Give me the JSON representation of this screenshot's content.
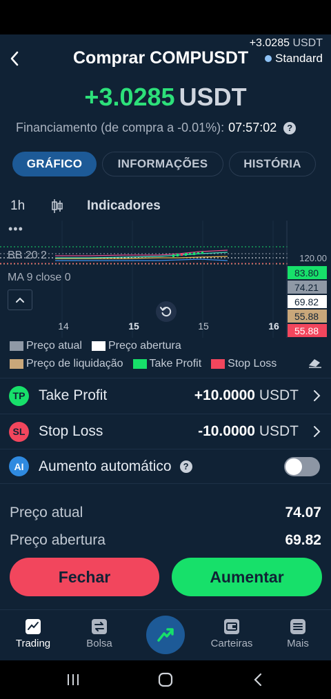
{
  "header": {
    "title": "Comprar COMPUSDT",
    "pnl_small": "+3.0285",
    "pnl_small_unit": "USDT",
    "mode": "Standard"
  },
  "pnl": {
    "value": "+3.0285",
    "unit": "USDT"
  },
  "funding": {
    "label": "Financiamento (de compra a -0.01%):",
    "countdown": "07:57:02"
  },
  "tabs": [
    {
      "label": "GRÁFICO",
      "active": true
    },
    {
      "label": "INFORMAÇÕES",
      "active": false
    },
    {
      "label": "HISTÓRIA",
      "active": false
    }
  ],
  "chart_toolbar": {
    "interval": "1h",
    "indicators_label": "Indicadores"
  },
  "chart_data": {
    "type": "line",
    "indicators": [
      "BB 20 2",
      "MA 9 close 0"
    ],
    "axis_top_label": "120.00",
    "price_tags": [
      {
        "label": "83.80",
        "kind": "Take Profit",
        "color": "#17e06a"
      },
      {
        "label": "74.21",
        "kind": "Preço atual",
        "color": "#8f99a6"
      },
      {
        "label": "69.82",
        "kind": "Preço abertura",
        "color": "#ffffff"
      },
      {
        "label": "55.88",
        "kind": "Preço de liquidação",
        "color": "#c9a77a"
      },
      {
        "label": "55.88",
        "kind": "Stop Loss",
        "color": "#f2465d"
      }
    ],
    "x_ticks": [
      {
        "label": "14",
        "bold": false
      },
      {
        "label": "15",
        "bold": true
      },
      {
        "label": "15",
        "bold": false
      },
      {
        "label": "16",
        "bold": true
      }
    ]
  },
  "legend": [
    {
      "label": "Preço atual",
      "color": "#8f99a6"
    },
    {
      "label": "Preço abertura",
      "color": "#ffffff"
    },
    {
      "label": "Preço de liquidação",
      "color": "#c9a77a"
    },
    {
      "label": "Take Profit",
      "color": "#17e06a"
    },
    {
      "label": "Stop Loss",
      "color": "#f2465d"
    }
  ],
  "take_profit": {
    "icon_text": "TP",
    "label": "Take Profit",
    "value": "+10.0000",
    "unit": "USDT"
  },
  "stop_loss": {
    "icon_text": "SL",
    "label": "Stop Loss",
    "value": "-10.0000",
    "unit": "USDT"
  },
  "auto_increase": {
    "icon_text": "AI",
    "label": "Aumento automático",
    "enabled": false
  },
  "info": {
    "current_price_label": "Preço atual",
    "current_price": "74.07",
    "open_price_label": "Preço abertura",
    "open_price": "69.82"
  },
  "actions": {
    "close_label": "Fechar",
    "increase_label": "Aumentar"
  },
  "bottom_nav": [
    {
      "label": "Trading",
      "icon": "chart-icon",
      "active": true
    },
    {
      "label": "Bolsa",
      "icon": "exchange-icon",
      "active": false
    },
    {
      "label": "",
      "icon": "trade-center-icon",
      "active": false
    },
    {
      "label": "Carteiras",
      "icon": "wallet-icon",
      "active": false
    },
    {
      "label": "Mais",
      "icon": "menu-icon",
      "active": false
    }
  ],
  "colors": {
    "background": "#102235",
    "accent": "#1d5a97",
    "profit": "#2de07a",
    "loss": "#f2465d"
  }
}
